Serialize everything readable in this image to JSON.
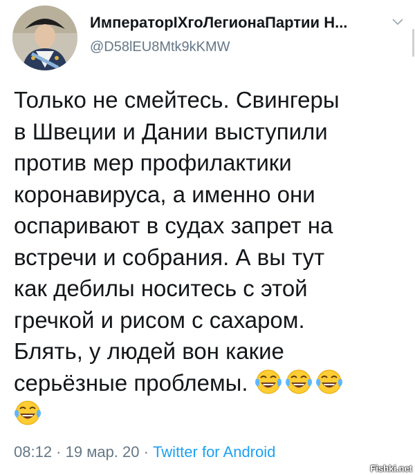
{
  "author": {
    "display_name": "ИмператорIХгоЛегионаПартии Н...",
    "handle": "@D58lEU8Mtk9kKMW",
    "avatar": "avatar-image",
    "menu_icon": "chevron-down-icon"
  },
  "tweet": {
    "lines": [
      "Только не смейтесь. Свингеры",
      "в Швеции и Дании выступили",
      "против мер профилактики",
      "коронавируса, а именно они",
      "оспаривают в судах запрет на",
      "встречи и собрания. А вы тут",
      "как дебилы носитесь с этой",
      "гречкой и рисом с сахаром.",
      "Блять, у людей вон какие",
      "серьёзные проблемы."
    ],
    "emoji": "tears-of-joy-emoji"
  },
  "meta": {
    "time": "08:12",
    "separator": " · ",
    "date": "19 мар. 20",
    "source": "Twitter for Android"
  },
  "watermark": "Fishki.net",
  "colors": {
    "text": "#14171a",
    "secondary": "#657786",
    "link": "#1da1f2"
  }
}
